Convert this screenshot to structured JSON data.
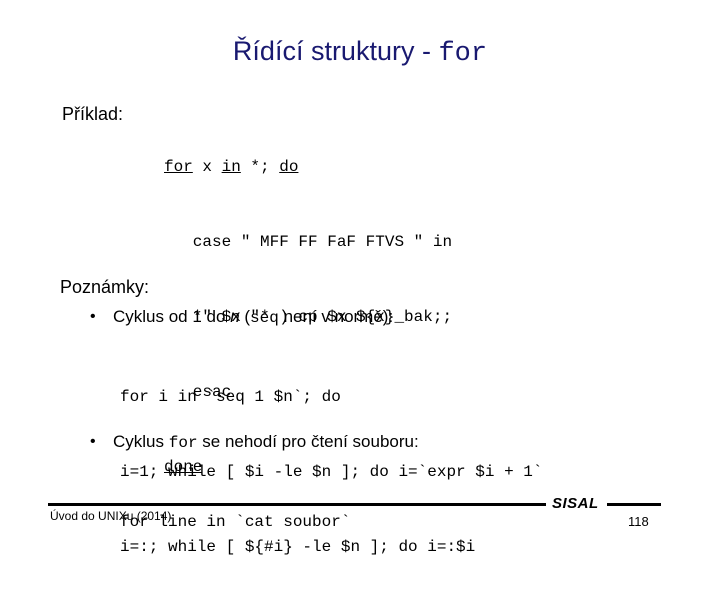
{
  "slide": {
    "title_prefix": "Řídící struktury - ",
    "title_keyword": "for",
    "title_color": "#191970"
  },
  "example": {
    "label": "Příklad:",
    "code_lines": [
      "for x in *; do",
      "   case \" MFF FF FaF FTVS \" in",
      "   *\" $x \"* ) cp $x ${x}_bak;;",
      "   esac",
      "done"
    ],
    "line1_tokens": {
      "kw_for": "for",
      "var_x": " x ",
      "kw_in": "in",
      "glob": " *; ",
      "kw_do": "do"
    },
    "line2": "   case \" MFF FF FaF FTVS \" in",
    "line3": "   *\" $x \"* ) cp $x ${x}_bak;;",
    "line4": "   esac",
    "line5_kw_done": "done"
  },
  "notes": {
    "heading": "Poznámky:",
    "bullet_glyph": "•",
    "items": [
      {
        "text_before": "Cyklus od 1 do ",
        "italic_var": "n",
        "text_paren_open": " (",
        "mono_cmd": "seq",
        "text_after": " není v normě):",
        "code_lines": [
          "for i in `seq 1 $n`; do",
          "i=1; while [ $i -le $n ]; do i=`expr $i + 1`",
          "i=:; while [ ${#i} -le $n ]; do i=:$i"
        ]
      },
      {
        "text_before": "Cyklus ",
        "mono_cmd": "for",
        "text_after": " se nehodí pro čtení souboru:",
        "code_lines": [
          "for line in `cat soubor`"
        ]
      }
    ]
  },
  "footer": {
    "source": "Úvod do UNIXu (2014)",
    "brand": "SISAL",
    "page_number": "118"
  }
}
